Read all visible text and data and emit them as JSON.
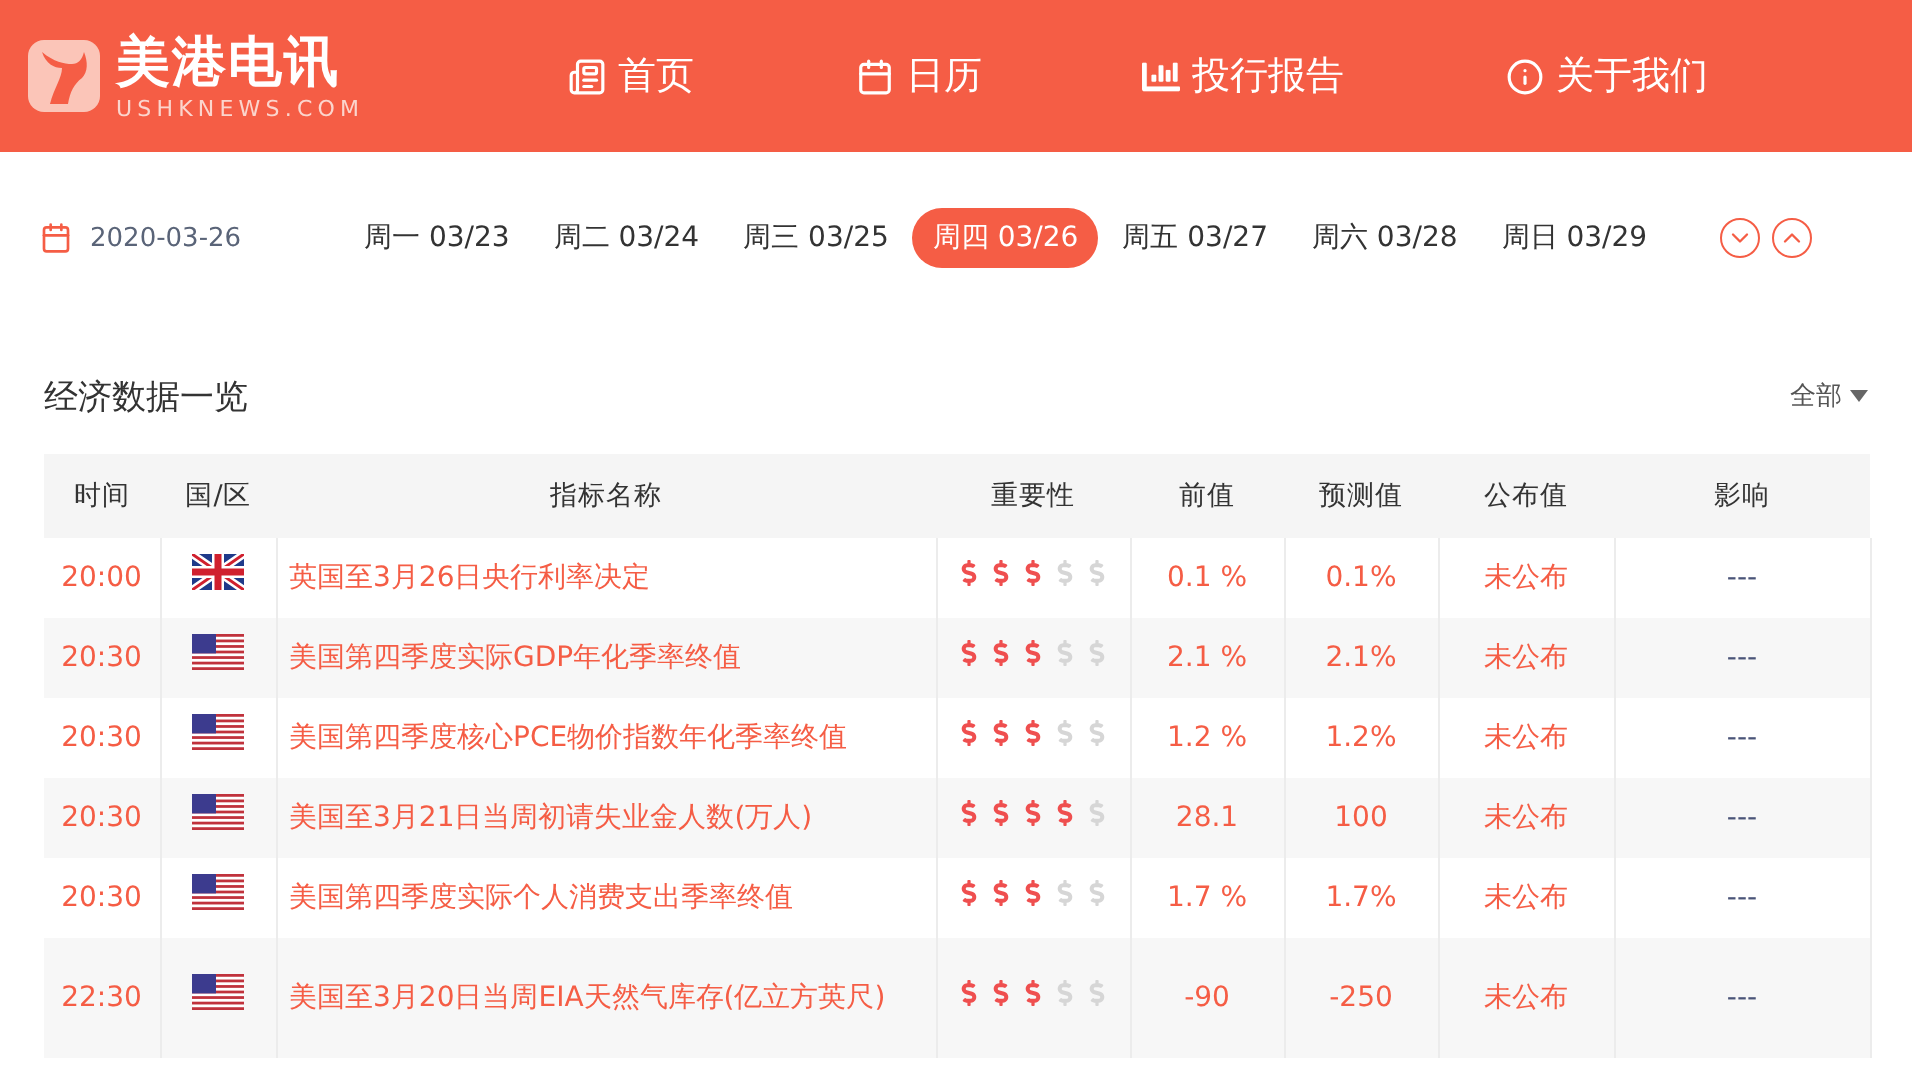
{
  "brand": {
    "name": "美港电讯",
    "domain": "USHKNEWS.COM"
  },
  "nav": [
    {
      "label": "首页",
      "kind": "news"
    },
    {
      "label": "日历",
      "kind": "calendar"
    },
    {
      "label": "投行报告",
      "kind": "chart"
    },
    {
      "label": "关于我们",
      "kind": "info"
    }
  ],
  "date": "2020-03-26",
  "days": [
    {
      "label": "周一 03/23",
      "selected": false
    },
    {
      "label": "周二 03/24",
      "selected": false
    },
    {
      "label": "周三 03/25",
      "selected": false
    },
    {
      "label": "周四 03/26",
      "selected": true
    },
    {
      "label": "周五 03/27",
      "selected": false
    },
    {
      "label": "周六 03/28",
      "selected": false
    },
    {
      "label": "周日 03/29",
      "selected": false
    }
  ],
  "section_title": "经济数据一览",
  "filter": "全部",
  "table": {
    "columns": [
      "时间",
      "国/区",
      "指标名称",
      "重要性",
      "前值",
      "预测值",
      "公布值",
      "影响"
    ],
    "rows": [
      {
        "time": "20:00",
        "kind": "uk",
        "name": "英国至3月26日央行利率决定",
        "stars": 3,
        "previous": "0.1 %",
        "forecast": "0.1%",
        "actual": "未公布",
        "impact": "---"
      },
      {
        "time": "20:30",
        "kind": "us",
        "name": "美国第四季度实际GDP年化季率终值",
        "stars": 3,
        "previous": "2.1 %",
        "forecast": "2.1%",
        "actual": "未公布",
        "impact": "---"
      },
      {
        "time": "20:30",
        "kind": "us",
        "name": "美国第四季度核心PCE物价指数年化季率终值",
        "stars": 3,
        "previous": "1.2 %",
        "forecast": "1.2%",
        "actual": "未公布",
        "impact": "---"
      },
      {
        "time": "20:30",
        "kind": "us",
        "name": "美国至3月21日当周初请失业金人数(万人)",
        "stars": 4,
        "previous": "28.1",
        "forecast": "100",
        "actual": "未公布",
        "impact": "---"
      },
      {
        "time": "20:30",
        "kind": "us",
        "name": "美国第四季度实际个人消费支出季率终值",
        "stars": 3,
        "previous": "1.7 %",
        "forecast": "1.7%",
        "actual": "未公布",
        "impact": "---"
      },
      {
        "time": "22:30",
        "kind": "us",
        "name": "美国至3月20日当周EIA天然气库存(亿立方英尺)",
        "stars": 3,
        "previous": "-90",
        "forecast": "-250",
        "actual": "未公布",
        "impact": "---"
      }
    ]
  }
}
